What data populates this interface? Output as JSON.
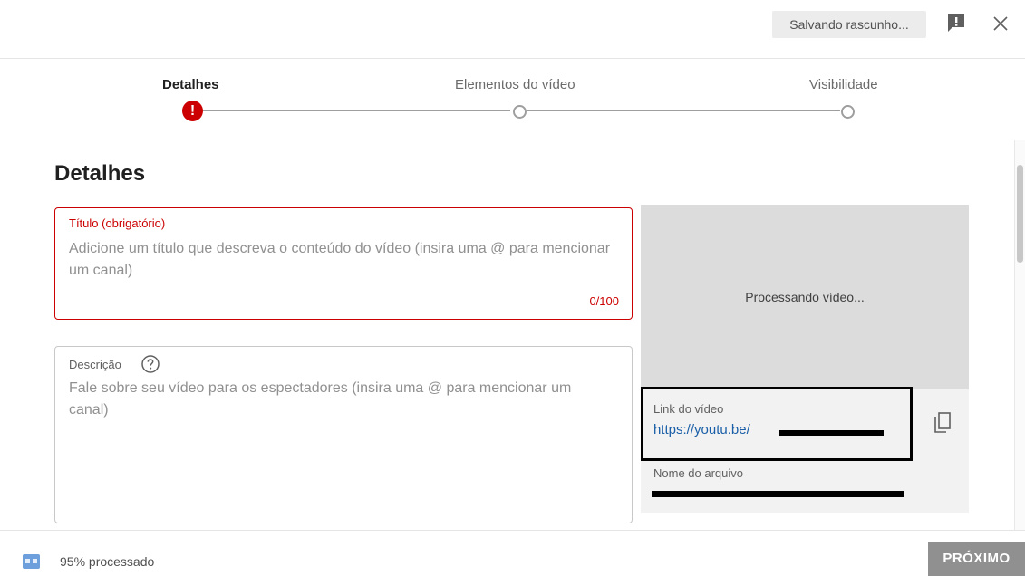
{
  "header": {
    "save_status": "Salvando rascunho...",
    "icons": {
      "feedback": "feedback-icon",
      "close": "close-icon"
    }
  },
  "stepper": {
    "steps": [
      {
        "label": "Detalhes",
        "state": "error"
      },
      {
        "label": "Elementos do vídeo",
        "state": "pending"
      },
      {
        "label": "Visibilidade",
        "state": "pending"
      }
    ],
    "error_symbol": "!"
  },
  "details": {
    "section_title": "Detalhes",
    "title_field": {
      "label": "Título (obrigatório)",
      "placeholder": "Adicione um título que descreva o conteúdo do vídeo (insira uma @ para mencionar um canal)",
      "value": "",
      "counter": "0/100"
    },
    "description_field": {
      "label": "Descrição",
      "placeholder": "Fale sobre seu vídeo para os espectadores (insira uma @ para mencionar um canal)",
      "value": "",
      "help_icon": "help-circle-icon"
    }
  },
  "preview": {
    "status": "Processando vídeo...",
    "link_label": "Link do vídeo",
    "link_url": "https://youtu.be/",
    "copy_icon": "copy-icon",
    "file_label": "Nome do arquivo"
  },
  "footer": {
    "status_icon": "processing-icon",
    "status_text": "95% processado",
    "next_label": "PRÓXIMO"
  },
  "colors": {
    "error": "#cc0000",
    "link": "#1a5fa8",
    "disabled_button": "#909090",
    "status_icon": "#6e9fdd"
  }
}
